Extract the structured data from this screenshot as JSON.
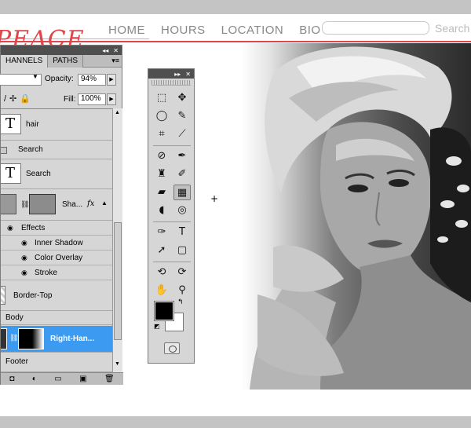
{
  "website": {
    "brand": "PEACE",
    "nav": [
      "HOME",
      "HOURS",
      "LOCATION",
      "BIO"
    ],
    "search_placeholder": "Search"
  },
  "layers_panel": {
    "tabs": [
      "HANNELS",
      "PATHS"
    ],
    "opacity_label": "Opacity:",
    "opacity_value": "94%",
    "fill_label": "Fill:",
    "fill_value": "100%",
    "layers": {
      "hair": "hair",
      "search_group": "Search",
      "search_text": "Search",
      "shape": "Sha...",
      "fx": "fx",
      "effects": "Effects",
      "inner_shadow": "Inner Shadow",
      "color_overlay": "Color Overlay",
      "stroke": "Stroke",
      "border_top": "Border-Top",
      "body": "Body",
      "selected": "Right-Han...",
      "footer": "Footer"
    }
  },
  "tools_panel": {
    "foreground": "#000000",
    "background": "#ffffff"
  }
}
